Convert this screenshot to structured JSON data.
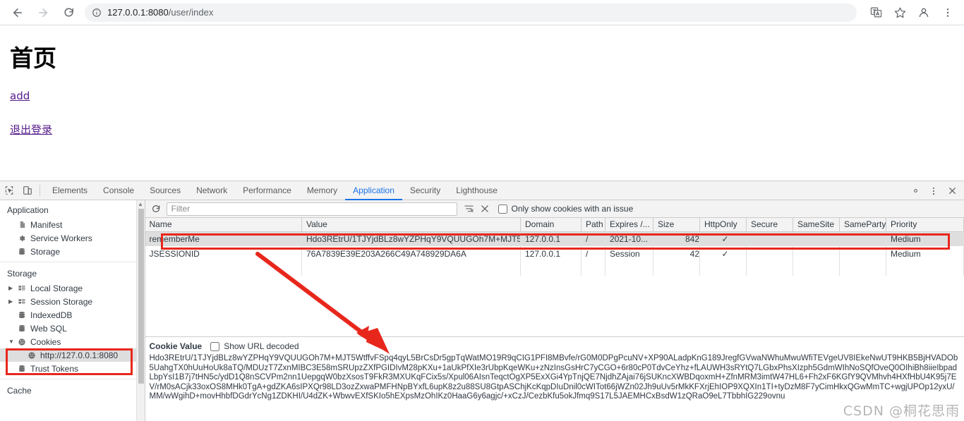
{
  "browser": {
    "back_label": "back-arrow",
    "forward_label": "forward-arrow",
    "reload_label": "reload",
    "url_host": "127.0.0.1:8080",
    "url_path": "/user/index",
    "url_full": "127.0.0.1:8080/user/index"
  },
  "page": {
    "title": "首页",
    "links": [
      {
        "label": "add"
      },
      {
        "label": "退出登录"
      }
    ]
  },
  "devtools": {
    "tabs": [
      {
        "label": "Elements",
        "active": false
      },
      {
        "label": "Console",
        "active": false
      },
      {
        "label": "Sources",
        "active": false
      },
      {
        "label": "Network",
        "active": false
      },
      {
        "label": "Performance",
        "active": false
      },
      {
        "label": "Memory",
        "active": false
      },
      {
        "label": "Application",
        "active": true
      },
      {
        "label": "Security",
        "active": false
      },
      {
        "label": "Lighthouse",
        "active": false
      }
    ],
    "sidebar": {
      "application_title": "Application",
      "application_items": [
        {
          "label": "Manifest",
          "icon": "document-icon"
        },
        {
          "label": "Service Workers",
          "icon": "gear-icon"
        },
        {
          "label": "Storage",
          "icon": "database-icon"
        }
      ],
      "storage_title": "Storage",
      "storage_items": [
        {
          "label": "Local Storage",
          "icon": "grid-icon",
          "twisty": "▶"
        },
        {
          "label": "Session Storage",
          "icon": "grid-icon",
          "twisty": "▶"
        },
        {
          "label": "IndexedDB",
          "icon": "database-icon",
          "twisty": ""
        },
        {
          "label": "Web SQL",
          "icon": "database-icon",
          "twisty": ""
        },
        {
          "label": "Cookies",
          "icon": "cookie-icon",
          "twisty": "▼"
        },
        {
          "label": "Trust Tokens",
          "icon": "database-icon",
          "twisty": ""
        }
      ],
      "cookie_origin": "http://127.0.0.1:8080",
      "cache_title": "Cache"
    },
    "toolbar": {
      "refresh_icon": "refresh-icon",
      "filter_placeholder": "Filter",
      "clear_filter_icon": "clear-filter-icon",
      "clear_all_icon": "clear-all-icon",
      "issue_checkbox_label": "Only show cookies with an issue",
      "issue_checkbox_checked": false
    },
    "table": {
      "columns": [
        "Name",
        "Value",
        "Domain",
        "Path",
        "Expires /...",
        "Size",
        "HttpOnly",
        "Secure",
        "SameSite",
        "SameParty",
        "Priority"
      ],
      "rows": [
        {
          "name": "rememberMe",
          "value": "Hdo3REtrU/1TJYjdBLz8wYZPHqY9VQUUGOh7M+MJT5...",
          "domain": "127.0.0.1",
          "path": "/",
          "expires": "2021-10...",
          "size": "842",
          "httponly": "✓",
          "secure": "",
          "samesite": "",
          "sameparty": "",
          "priority": "Medium",
          "selected": true
        },
        {
          "name": "JSESSIONID",
          "value": "76A7839E39E203A266C49A748929DA6A",
          "domain": "127.0.0.1",
          "path": "/",
          "expires": "Session",
          "size": "42",
          "httponly": "✓",
          "secure": "",
          "samesite": "",
          "sameparty": "",
          "priority": "Medium",
          "selected": false
        }
      ]
    },
    "cookie_value_pane": {
      "title": "Cookie Value",
      "url_decoded_label": "Show URL decoded",
      "url_decoded_checked": false,
      "value": "Hdo3REtrU/1TJYjdBLz8wYZPHqY9VQUUGOh7M+MJT5WtffvFSpq4qyL5BrCsDr5gpTqWatMO19R9qCIG1PFI8MBvfe/rG0M0DPgPcuNV+XP90ALadpKnG189JregfGVwaNWhuMwuWfiTEVgeUV8IEkeNwUT9HKB5BjHVADOb5UahgTX0hUuHoUk8aTQ/MDUzT7ZxnMIBC3E58mSRUpzZXfPGIDIvM28pKXu+1aUkPfXIe3rUbpKqeWKu+zNzInsGsHrC7yCGO+6r80cP0TdvCeYhz+fLAUWH3sRYtQ7LGbxPhsXIzph5GdmWIhNoSQfOveQ0OIhiBh8iieIbpadLbpYsI1B7j7tHN5c/ydD1Q8nSCVPm2nn1UepgqW0bzXsosT9FkR3MXUKqFCix5s/Xpul06AIsnTeqctOgXP5ExXGi4YpTnjQE7NjdhZAjai76jSUKncXWBDqoxmH+ZfnMRM3imtW47HL6+Fh2xF6KGfY9QVMhvh4HXfHbU4K95j7EV/rM0sACjk33oxOS8MHk0TgA+gdZKA6sIPXQr98LD3ozZxwaPMFHNpBYxfL6upK8z2u88SU8GtpASChjKcKqpDIuDnil0cWITot66jWZn02Jh9uUv5rMkKFXrjEhIOP9XQXIn1TI+tyDzM8F7yCimHkxQGwMmTC+wgjUPOp12yxU/MM/wWgihD+movHhbfDGdrYcNg1ZDKHI/U4dZK+WbwvEXfSKIo5hEXpsMzOhIKz0HaaG6y6agjc/+xCzJ/CezbKfu5okJfmq9S17L5JAEMHCxBsdW1zQRaO9eL7TbbhIG229ovnu"
    }
  },
  "annotations": {
    "watermark": "CSDN @桐花思雨",
    "highlight_color": "#e8271c"
  }
}
